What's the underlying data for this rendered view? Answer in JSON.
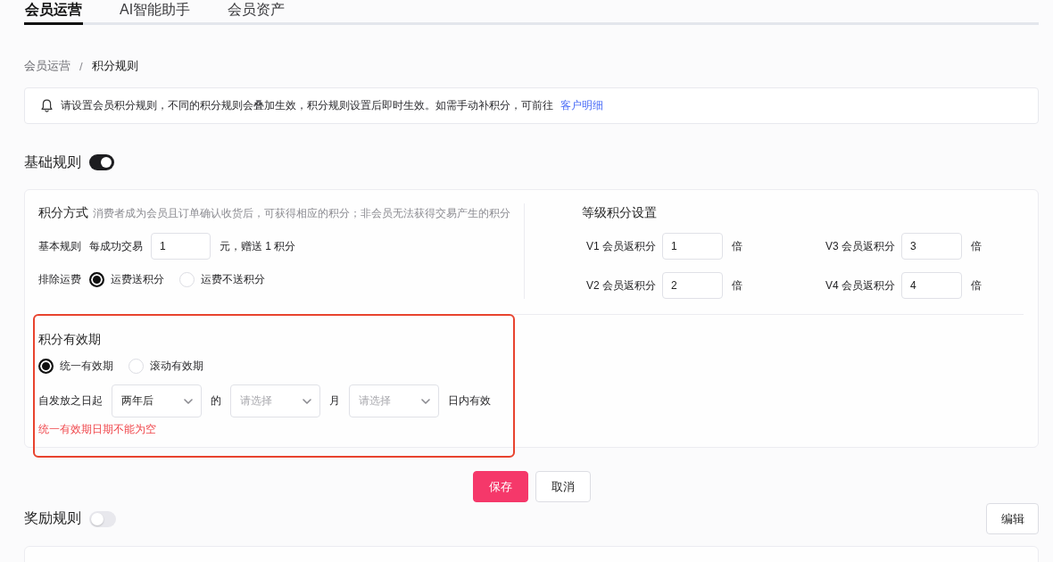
{
  "tabs": [
    {
      "label": "会员运营",
      "selected": true
    },
    {
      "label": "AI智能助手",
      "selected": false
    },
    {
      "label": "会员资产",
      "selected": false
    }
  ],
  "breadcrumb": {
    "separator": "/",
    "items": [
      {
        "label": "会员运营",
        "current": false
      },
      {
        "label": "积分规则",
        "current": true
      }
    ]
  },
  "notice": {
    "text": "请设置会员积分规则，不同的积分规则会叠加生效，积分规则设置后即时生效。如需手动补积分，可前往",
    "link": "客户明细"
  },
  "basic_rules": {
    "title": "基础规则",
    "enabled": true,
    "earning": {
      "title": "积分方式",
      "description": "消费者成为会员且订单确认收货后，可获得相应的积分；非会员无法获得交易产生的积分",
      "rule": {
        "label": "基本规则",
        "prefix": "每成功交易",
        "value": "1",
        "suffix": "元，赠送 1 积分"
      },
      "shipping": {
        "label": "排除运费",
        "options": [
          {
            "label": "运费送积分",
            "selected": true
          },
          {
            "label": "运费不送积分",
            "selected": false
          }
        ]
      }
    },
    "levels": {
      "title": "等级积分设置",
      "items": [
        {
          "label": "V1 会员返积分",
          "value": "1",
          "unit": "倍"
        },
        {
          "label": "V3 会员返积分",
          "value": "3",
          "unit": "倍"
        },
        {
          "label": "V2 会员返积分",
          "value": "2",
          "unit": "倍"
        },
        {
          "label": "V4 会员返积分",
          "value": "4",
          "unit": "倍"
        }
      ]
    },
    "validity": {
      "title": "积分有效期",
      "highlighted": true,
      "options": [
        {
          "label": "统一有效期",
          "selected": true
        },
        {
          "label": "滚动有效期",
          "selected": false
        }
      ],
      "fields": [
        {
          "kind": "text",
          "text": "自发放之日起"
        },
        {
          "kind": "select",
          "value": "两年后"
        },
        {
          "kind": "text",
          "text": "的"
        },
        {
          "kind": "select",
          "placeholder": "请选择"
        },
        {
          "kind": "text",
          "text": "月"
        },
        {
          "kind": "select",
          "placeholder": "请选择"
        },
        {
          "kind": "text",
          "text": "日内有效"
        }
      ],
      "error": "统一有效期日期不能为空"
    }
  },
  "actions": [
    {
      "label": "保存",
      "kind": "save"
    },
    {
      "label": "取消",
      "kind": "cancel"
    }
  ],
  "reward_rules": {
    "title": "奖励规则",
    "enabled": false,
    "edit_button": "编辑"
  }
}
